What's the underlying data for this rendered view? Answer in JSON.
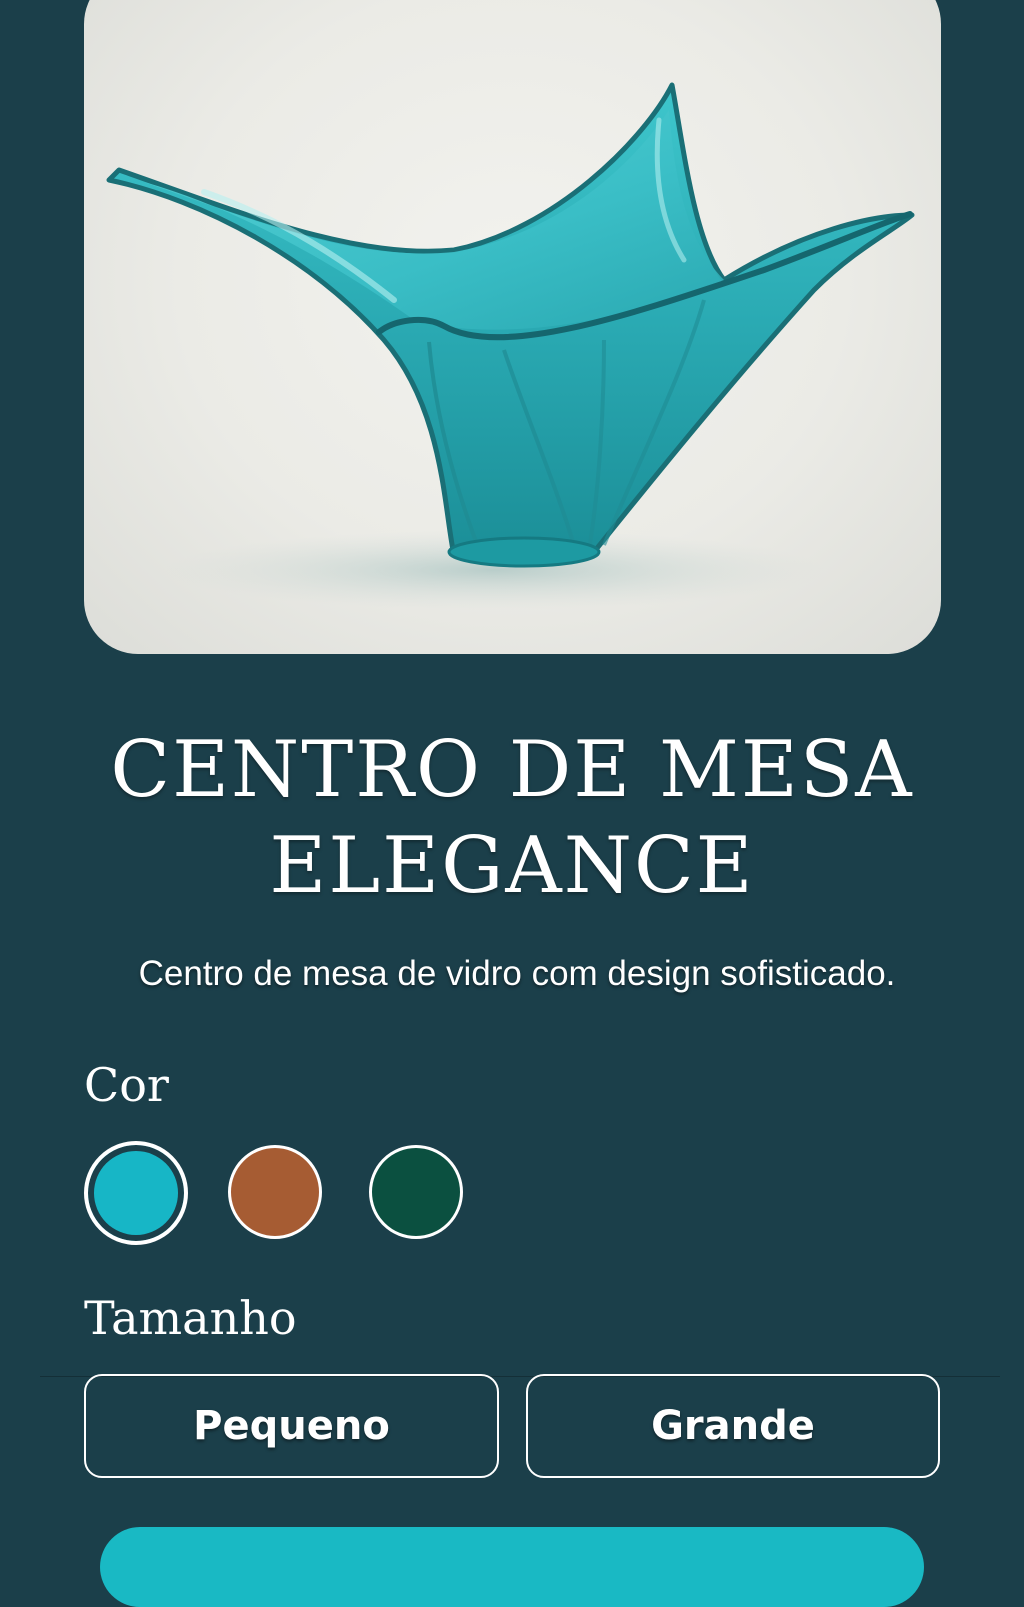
{
  "product": {
    "image_alt": "vase-icon",
    "title_line1": "CENTRO DE MESA",
    "title_line2": "ELEGANCE",
    "description": "Centro de mesa de vidro com design sofisticado."
  },
  "options": {
    "color_label": "Cor",
    "colors": [
      {
        "name": "turquoise",
        "hex": "#17b6c6",
        "selected": true
      },
      {
        "name": "copper",
        "hex": "#a65c33",
        "selected": false
      },
      {
        "name": "forest-green",
        "hex": "#0b5040",
        "selected": false
      }
    ],
    "size_label": "Tamanho",
    "sizes": [
      "Pequeno",
      "Grande"
    ]
  },
  "theme": {
    "background": "#1b3f4a",
    "accent": "#19b9c4",
    "glass": "#2fb4bd"
  }
}
